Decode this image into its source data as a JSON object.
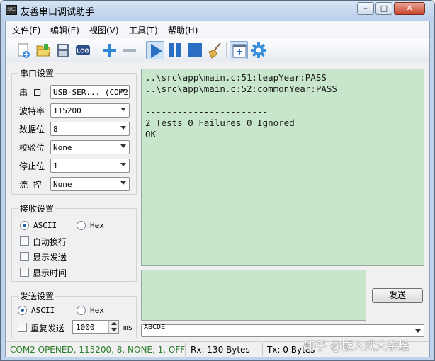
{
  "window": {
    "title": "友善串口调试助手",
    "app_icon_text": "SRC",
    "minimize_glyph": "–",
    "maximize_glyph": "□",
    "close_glyph": "✕"
  },
  "menu": [
    "文件(F)",
    "编辑(E)",
    "视图(V)",
    "工具(T)",
    "帮助(H)"
  ],
  "toolbar": {
    "buttons": [
      "new-file-icon",
      "open-folder-icon",
      "save-disk-icon",
      "log-icon",
      "plus-icon",
      "minus-icon",
      "play-icon",
      "pause-icon",
      "stop-icon",
      "broom-clear-icon",
      "window-add-icon",
      "gear-icon"
    ],
    "log_text": "LOG"
  },
  "serial_settings": {
    "title": "串口设置",
    "fields": [
      {
        "label": "串  口",
        "value": "USB-SER... (COM2"
      },
      {
        "label": "波特率",
        "value": "115200"
      },
      {
        "label": "数据位",
        "value": "8"
      },
      {
        "label": "校验位",
        "value": "None"
      },
      {
        "label": "停止位",
        "value": "1"
      },
      {
        "label": "流  控",
        "value": "None"
      }
    ]
  },
  "receive_settings": {
    "title": "接收设置",
    "ascii_label": "ASCII",
    "hex_label": "Hex",
    "selected": "ASCII",
    "options": [
      "自动换行",
      "显示发送",
      "显示时间"
    ]
  },
  "send_settings": {
    "title": "发送设置",
    "ascii_label": "ASCII",
    "hex_label": "Hex",
    "selected": "ASCII",
    "repeat_label": "重复发送",
    "interval_value": "1000",
    "interval_unit": "ms"
  },
  "receive_area": {
    "text": "..\\src\\app\\main.c:51:leapYear:PASS\n..\\src\\app\\main.c:52:commonYear:PASS\n\n-----------------------\n2 Tests 0 Failures 0 Ignored\nOK"
  },
  "send_area": {
    "send_button": "发送",
    "history_value": "ABCDE"
  },
  "statusbar": {
    "port_status": "COM2 OPENED, 115200, 8, NONE, 1, OFF",
    "rx": "Rx: 130 Bytes",
    "tx": "Tx: 0 Bytes"
  },
  "watermark": "知乎 @嵌入式大杂烩",
  "colors": {
    "port_status": "#2a7d2a",
    "accent_blue": "#2a6fc4",
    "terminal_bg": "#c8e6cb"
  }
}
